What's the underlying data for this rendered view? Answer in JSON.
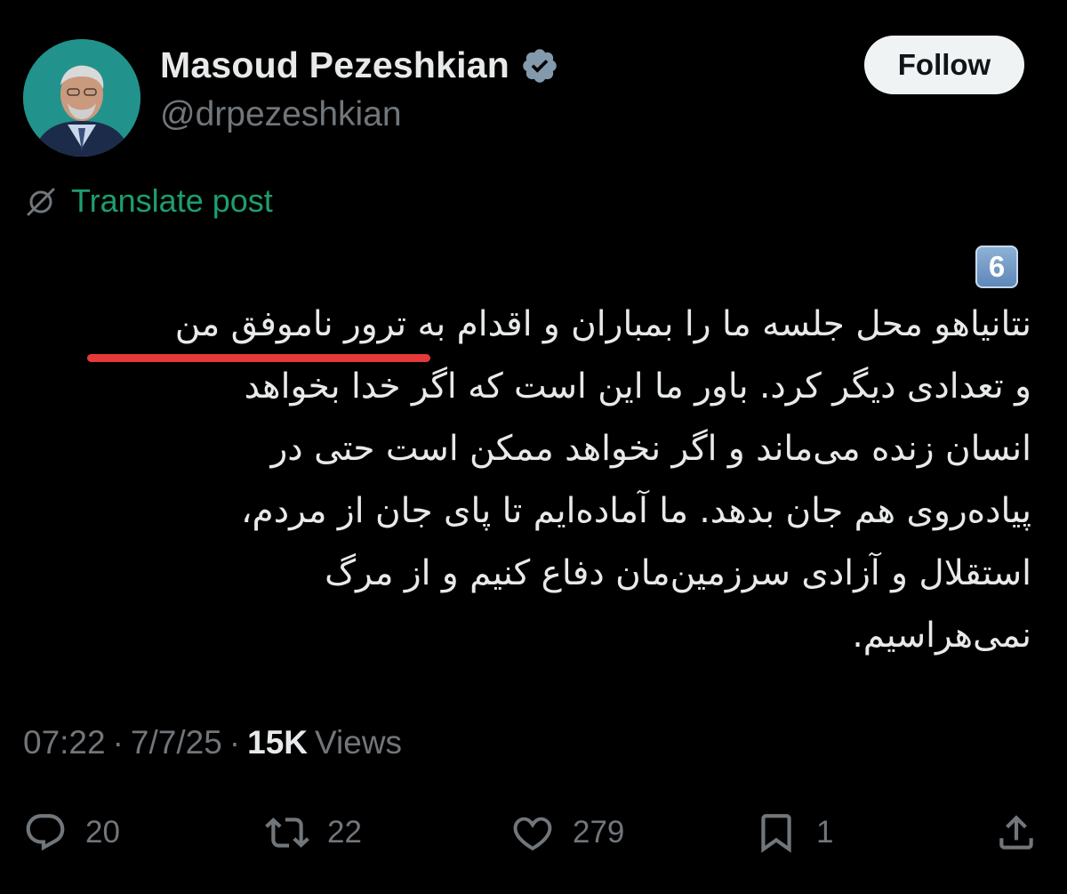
{
  "author": {
    "display_name": "Masoud Pezeshkian",
    "handle": "@drpezeshkian",
    "verified": true
  },
  "follow_button_label": "Follow",
  "translate_label": "Translate post",
  "post": {
    "number_emoji": "6",
    "lines": [
      "نتانیاهو محل جلسه ما را بمباران و اقدام به ترور ناموفق من",
      "و تعدادی دیگر کرد. باور ما این است که اگر خدا بخواهد",
      "انسان زنده می‌ماند و اگر نخواهد ممکن است حتی در",
      "پیاده‌روی هم جان بدهد. ما آماده‌ایم تا پای جان از مردم،",
      "استقلال و آزادی سرزمین‌مان دفاع کنیم و از مرگ",
      "نمی‌هراسیم."
    ]
  },
  "meta": {
    "time": "07:22",
    "separator": "·",
    "date": "7/7/25",
    "views_count": "15K",
    "views_label": "Views"
  },
  "actions": {
    "replies": "20",
    "reposts": "22",
    "likes": "279",
    "bookmarks": "1"
  },
  "colors": {
    "background": "#000000",
    "text": "#e7e9ea",
    "muted": "#71767b",
    "translate_link": "#1d9e6e",
    "verified_badge": "#829aab",
    "underline": "#e53a3a"
  },
  "icons": {
    "verified": "verified-badge-icon",
    "translate": "globe-slash-icon",
    "reply": "speech-bubble-icon",
    "repost": "repost-arrows-icon",
    "like": "heart-icon",
    "bookmark": "bookmark-icon",
    "share": "share-upload-icon"
  }
}
